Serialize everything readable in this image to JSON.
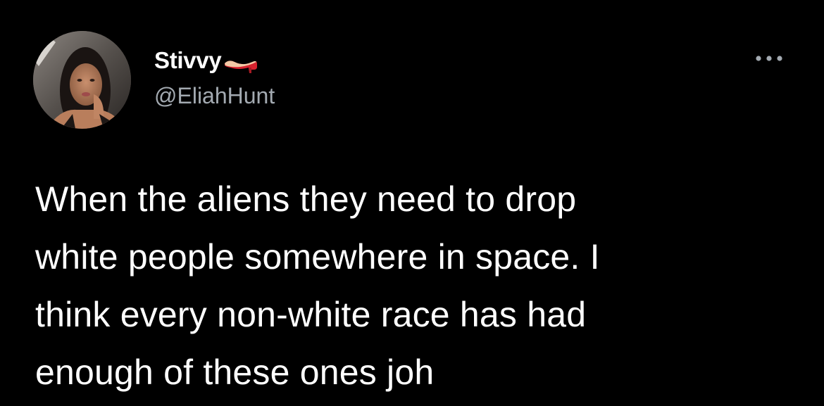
{
  "tweet": {
    "author": {
      "display_name": "Stivvy",
      "handle": "@EliahHunt",
      "name_icon": "high-heel-emoji-icon",
      "avatar_icon": "profile-photo"
    },
    "menu_icon": "more-horizontal-icon",
    "text_lines": [
      "When the aliens they need to drop",
      "white people somewhere in space. I",
      "think every non-white race has had",
      "enough of these ones joh"
    ]
  },
  "colors": {
    "background": "#000000",
    "primary_text": "#ffffff",
    "secondary_text": "#a3aab1",
    "emoji_red": "#d7222e"
  }
}
